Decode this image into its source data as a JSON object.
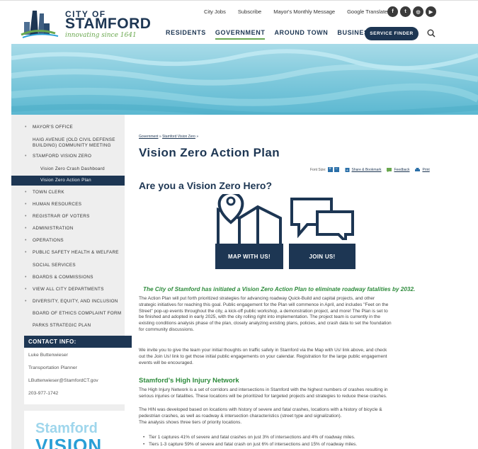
{
  "header": {
    "logo": {
      "city": "CITY OF",
      "name": "STAMFORD",
      "tagline": "innovating since 1641"
    },
    "top_links": [
      "City Jobs",
      "Subscribe",
      "Mayor's Monthly Message",
      "Google Translate"
    ],
    "social_icons": [
      "facebook-icon",
      "twitter-icon",
      "instagram-icon",
      "youtube-icon"
    ],
    "main_nav": [
      {
        "label": "RESIDENTS",
        "active": false
      },
      {
        "label": "GOVERNMENT",
        "active": true
      },
      {
        "label": "AROUND TOWN",
        "active": false
      },
      {
        "label": "BUSINESS",
        "active": false
      }
    ],
    "service_finder": "SERVICE FINDER"
  },
  "sidebar": {
    "items": [
      {
        "label": "MAYOR'S OFFICE",
        "bullet": true,
        "level": 0
      },
      {
        "label": "HAIG AVENUE (OLD CIVIL DEFENSE",
        "label2": "BUILDING) COMMUNITY MEETING",
        "bullet": false,
        "level": 0
      },
      {
        "label": "STAMFORD VISION ZERO",
        "bullet": true,
        "level": 0
      },
      {
        "label": "Vision Zero Crash Dashboard",
        "bullet": false,
        "level": 1
      },
      {
        "label": "Vision Zero Action Plan",
        "bullet": false,
        "level": 1,
        "active": true
      },
      {
        "label": "TOWN CLERK",
        "bullet": true,
        "level": 0
      },
      {
        "label": "HUMAN RESOURCES",
        "bullet": true,
        "level": 0
      },
      {
        "label": "REGISTRAR OF VOTERS",
        "bullet": true,
        "level": 0
      },
      {
        "label": "ADMINISTRATION",
        "bullet": true,
        "level": 0
      },
      {
        "label": "OPERATIONS",
        "bullet": true,
        "level": 0
      },
      {
        "label": "PUBLIC SAFETY HEALTH & WELFARE",
        "bullet": true,
        "level": 0
      },
      {
        "label": "SOCIAL SERVICES",
        "bullet": false,
        "level": 0
      },
      {
        "label": "BOARDS & COMMISSIONS",
        "bullet": true,
        "level": 0
      },
      {
        "label": "VIEW ALL CITY DEPARTMENTS",
        "bullet": true,
        "level": 0
      },
      {
        "label": "DIVERSITY, EQUITY, AND INCLUSION",
        "bullet": true,
        "level": 0
      },
      {
        "label": "BOARD OF ETHICS COMPLAINT FORM",
        "bullet": false,
        "level": 0
      },
      {
        "label": "PARKS STRATEGIC PLAN",
        "bullet": false,
        "level": 0
      }
    ],
    "contact": {
      "header": "CONTACT INFO:",
      "name": "Luke Buttenwieser",
      "title": "Transportation Planner",
      "email": "LButtenwieser@StamfordCT.gov",
      "phone": "203-977-1742"
    },
    "promo": {
      "line1": "Stamford",
      "line2": "VISION"
    }
  },
  "main": {
    "breadcrumb": {
      "item1": "Government",
      "sep": " » ",
      "item2": "Stamford Vision Zero",
      "tail": " »"
    },
    "title": "Vision Zero Action Plan",
    "tools": {
      "font_size": "Font Size:",
      "share": "Share & Bookmark",
      "feedback": "Feedback",
      "print": "Print"
    },
    "hero_question": "Are you a Vision Zero Hero?",
    "map_button": "MAP WITH US!",
    "join_button": "JOIN US!",
    "tagline": "The City of Stamford has initiated a Vision Zero Action Plan to eliminate roadway fatalities by 2032.",
    "p1": [
      "The Action Plan will put forth prioritized strategies for advancing roadway Quick-Build and capital projects, and other",
      "strategic initiatives for reaching this goal. Public engagement for the Plan will commence in April, and includes \"Feet on the",
      "Street\" pop-up events throughout the city, a kick-off public workshop, a demonstration project, and more! The Plan is set to",
      "be finished and adopted in early 2025, with the city rolling right into implementation. The project team is currently in the",
      "existing conditions analysis phase of the plan, closely analyzing existing plans, policies, and crash data to set the foundation",
      "for community discussions."
    ],
    "p2": [
      "We invite you to give the team your initial thoughts on traffic safety in Stamford via the Map with Us! link above, and check",
      "out the Join Us! link to get those initial public engagements on your calendar. Registration for the large public engagement",
      "events will be encouraged."
    ],
    "hin_title": "Stamford's High Injury Network",
    "p3": [
      "The High Injury Network is a set of corridors and intersections in Stamford with the highest numbers of crashes resulting in",
      "serious injuries or fatalities. These locations will be prioritized for targeted projects and strategies to reduce these crashes."
    ],
    "p4": [
      "The HIN was developed based on locations with history of severe and fatal crashes, locations with a history of bicycle &",
      "pedestrian crashes, as well as roadway & intersection characteristics (street type and signalization).",
      "The analysis shows three tiers of priority locations."
    ],
    "bullets": [
      "Tier 1 captures 41% of severe and fatal crashes on just 3% of intersections and 4% of roadway miles.",
      "Tiers 1-3 capture 59% of severe and fatal crash on just 6% of intersections and 15% of roadway miles."
    ]
  }
}
